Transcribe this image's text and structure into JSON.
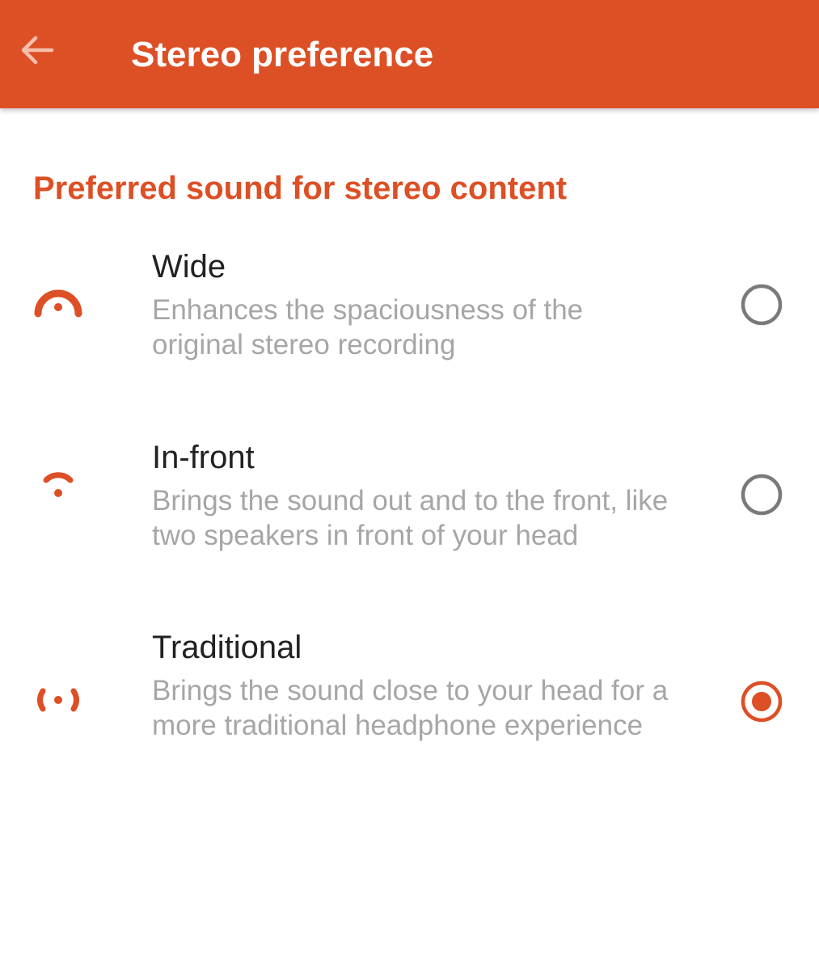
{
  "app_bar": {
    "title": "Stereo preference",
    "back_icon": "arrow-left-icon"
  },
  "section": {
    "header": "Preferred sound for stereo content"
  },
  "colors": {
    "accent": "#dd4f25",
    "title_text": "#212121",
    "secondary_text": "#a6a6a6",
    "radio_unselected": "#7a7a7a"
  },
  "options": [
    {
      "title": "Wide",
      "description": "Enhances the spaciousness of the original stereo recording",
      "icon": "wide-sound-icon",
      "selected": false
    },
    {
      "title": "In-front",
      "description": "Brings the sound out and to the front, like two speakers in front of your head",
      "icon": "in-front-sound-icon",
      "selected": false
    },
    {
      "title": "Traditional",
      "description": "Brings the sound close to your head for a more traditional headphone experience",
      "icon": "traditional-sound-icon",
      "selected": true
    }
  ]
}
